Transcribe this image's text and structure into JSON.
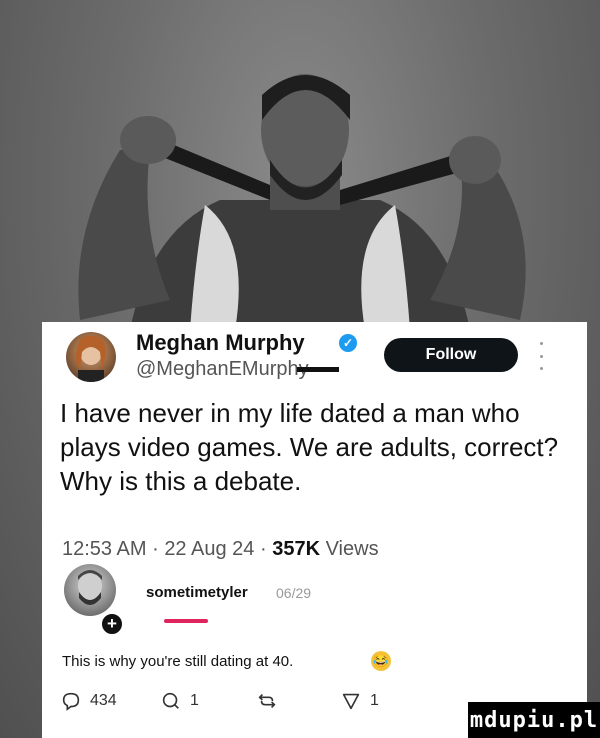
{
  "tweet": {
    "author_name": "Meghan Murphy",
    "author_handle": "@MeghanEMurphy",
    "follow_label": "Follow",
    "text": "I have never in my life dated a man who plays video games. We are adults, correct? Why is this a debate.",
    "time": "12:53 AM",
    "date": "22 Aug 24",
    "views_count": "357K",
    "views_label": "Views",
    "separator": "·"
  },
  "reply": {
    "username": "sometimetyler",
    "date": "06/29",
    "text": "This is why you're still dating at 40."
  },
  "actions": {
    "comments_count": "434",
    "quotes_count": "1",
    "likes_count": "1"
  },
  "watermark": "mdupiu.pl",
  "icons": [
    "verified-badge-icon",
    "more-icon",
    "plus-icon",
    "laughing-emoji-icon",
    "comment-icon",
    "quote-icon",
    "retweet-icon",
    "heart-icon"
  ]
}
